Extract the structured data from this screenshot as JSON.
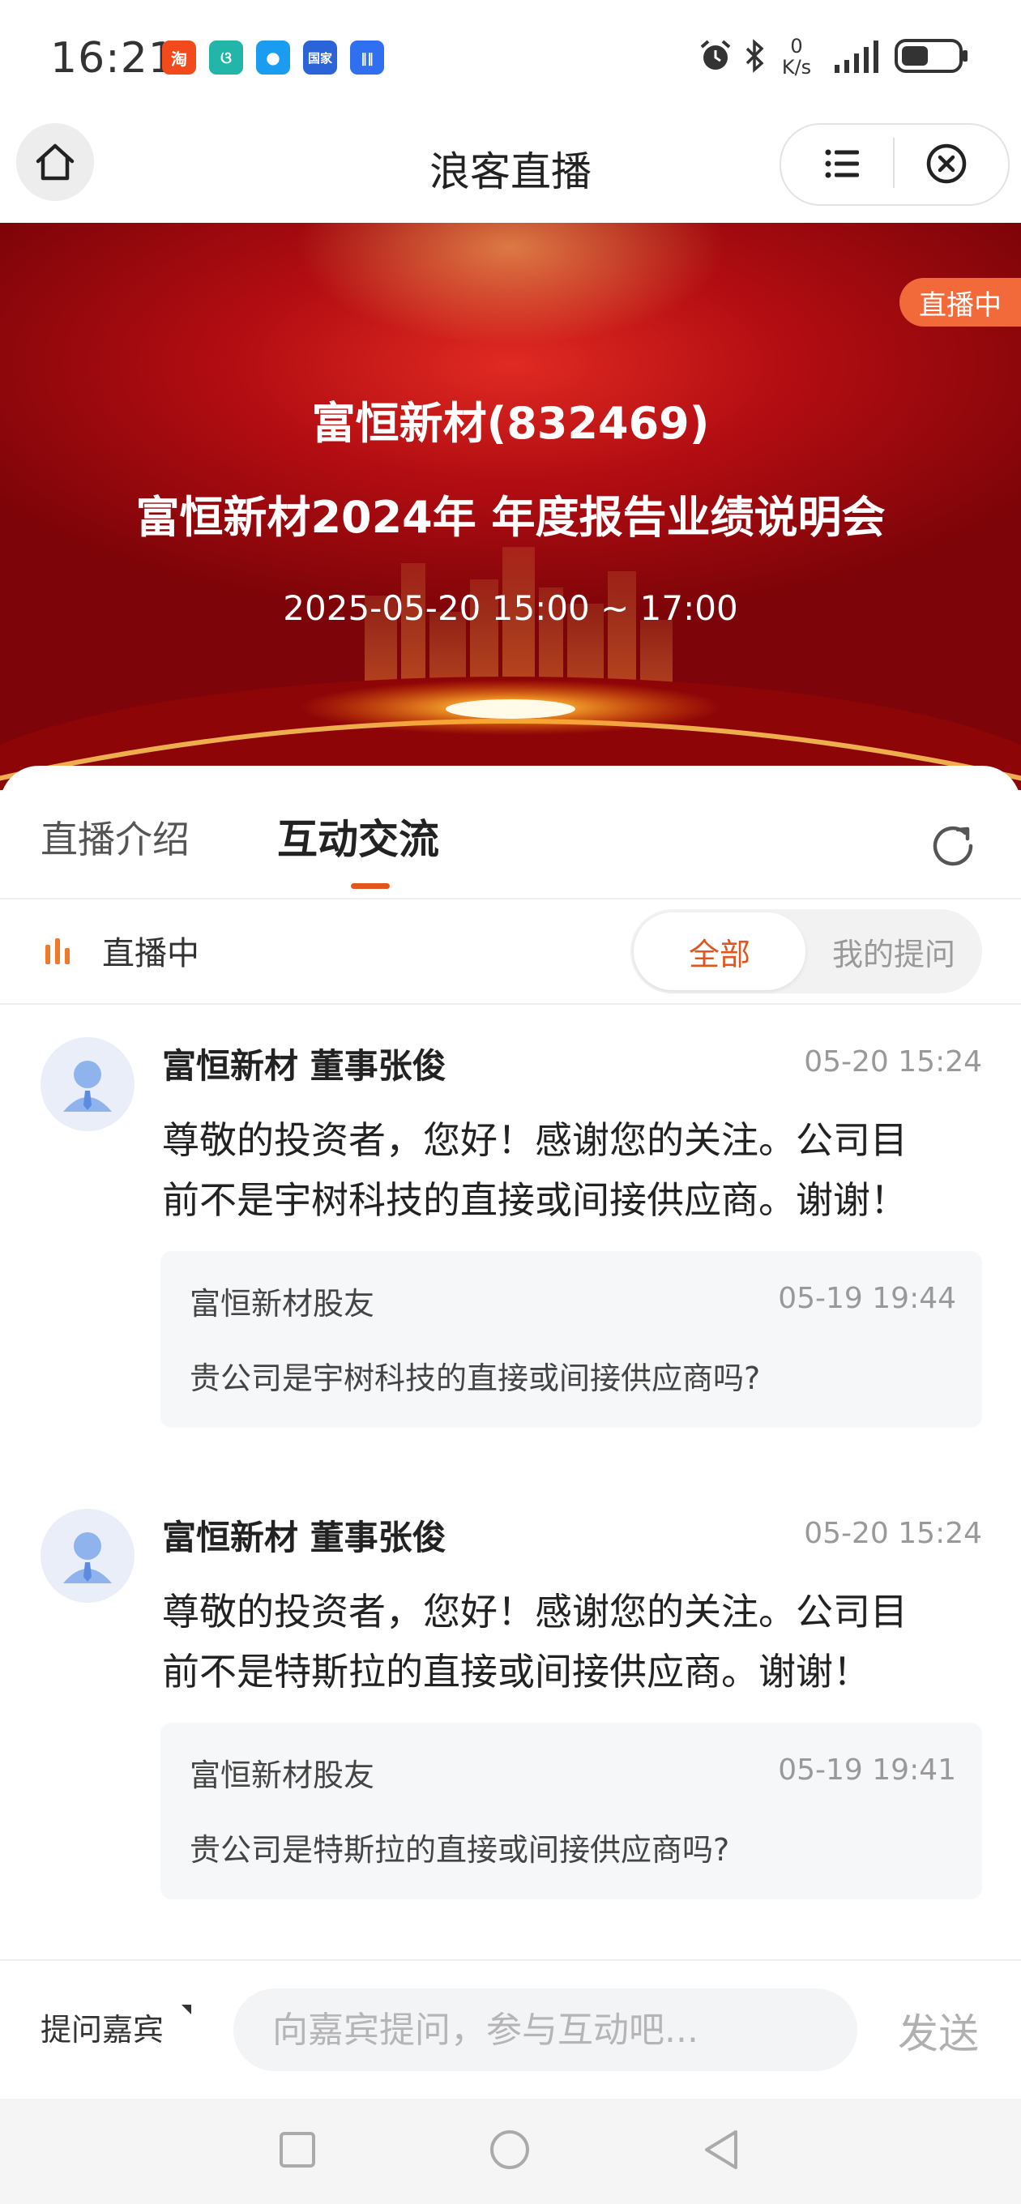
{
  "status_bar": {
    "time": "16:21",
    "app_icons": [
      {
        "name": "taobao-icon",
        "glyph": "淘",
        "color": "#f24a1c"
      },
      {
        "name": "spiral-app-icon",
        "glyph": "ଓ",
        "color": "#21b6a8"
      },
      {
        "name": "message-app-icon",
        "glyph": "●",
        "color": "#1a9cf0"
      },
      {
        "name": "gov-app-icon",
        "glyph": "国家",
        "color": "#2b63d9"
      },
      {
        "name": "voice-app-icon",
        "glyph": "‖‖",
        "color": "#2f6ff0"
      }
    ],
    "net_speed_value": "0",
    "net_speed_unit": "K/s"
  },
  "title_bar": {
    "title": "浪客直播"
  },
  "banner": {
    "live_badge": "直播中",
    "line1": "富恒新材(832469)",
    "line2": "富恒新材2024年 年度报告业绩说明会",
    "line3": "2025-05-20 15:00 ~ 17:00"
  },
  "tabs": [
    {
      "label": "直播介绍",
      "active": false
    },
    {
      "label": "互动交流",
      "active": true
    }
  ],
  "filter_bar": {
    "status": "直播中",
    "segments": [
      "全部",
      "我的提问"
    ],
    "selected": "全部"
  },
  "messages": [
    {
      "author": "富恒新材 董事张俊",
      "time": "05-20 15:24",
      "answer_line1": "尊敬的投资者，您好！感谢您的关注。公司目",
      "answer_line2": "前不是宇树科技的直接或间接供应商。谢谢！",
      "question": {
        "author": "富恒新材股友",
        "time": "05-19 19:44",
        "text": "贵公司是宇树科技的直接或间接供应商吗?"
      }
    },
    {
      "author": "富恒新材 董事张俊",
      "time": "05-20 15:24",
      "answer_line1": "尊敬的投资者，您好！感谢您的关注。公司目",
      "answer_line2": "前不是特斯拉的直接或间接供应商。谢谢！",
      "question": {
        "author": "富恒新材股友",
        "time": "05-19 19:41",
        "text": "贵公司是特斯拉的直接或间接供应商吗?"
      }
    }
  ],
  "bottom_bar": {
    "ask_guest_label": "提问嘉宾",
    "input_placeholder": "向嘉宾提问，参与互动吧...",
    "send_label": "发送"
  },
  "colors": {
    "accent": "#e2561e",
    "banner_red": "#b30d12",
    "live_badge": "#f26a3a"
  }
}
